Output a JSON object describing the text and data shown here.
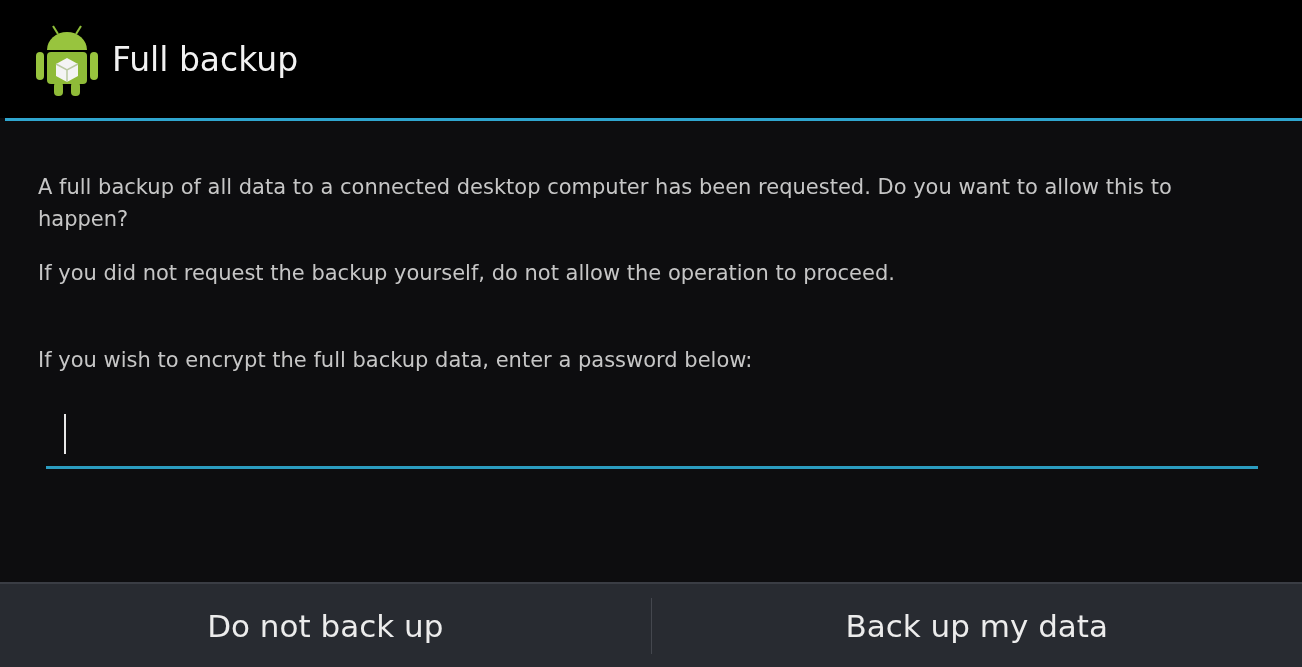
{
  "dialog": {
    "title": "Full backup",
    "paragraphs": [
      "A full backup of all data to a connected desktop computer has been requested. Do you want to allow this to happen?",
      "If you did not request the backup yourself, do not allow the operation to proceed.",
      "If you wish to encrypt the full backup data, enter a password below:"
    ],
    "password_field": {
      "focused": true
    },
    "buttons": [
      "Do not back up",
      "Back up my data"
    ]
  }
}
